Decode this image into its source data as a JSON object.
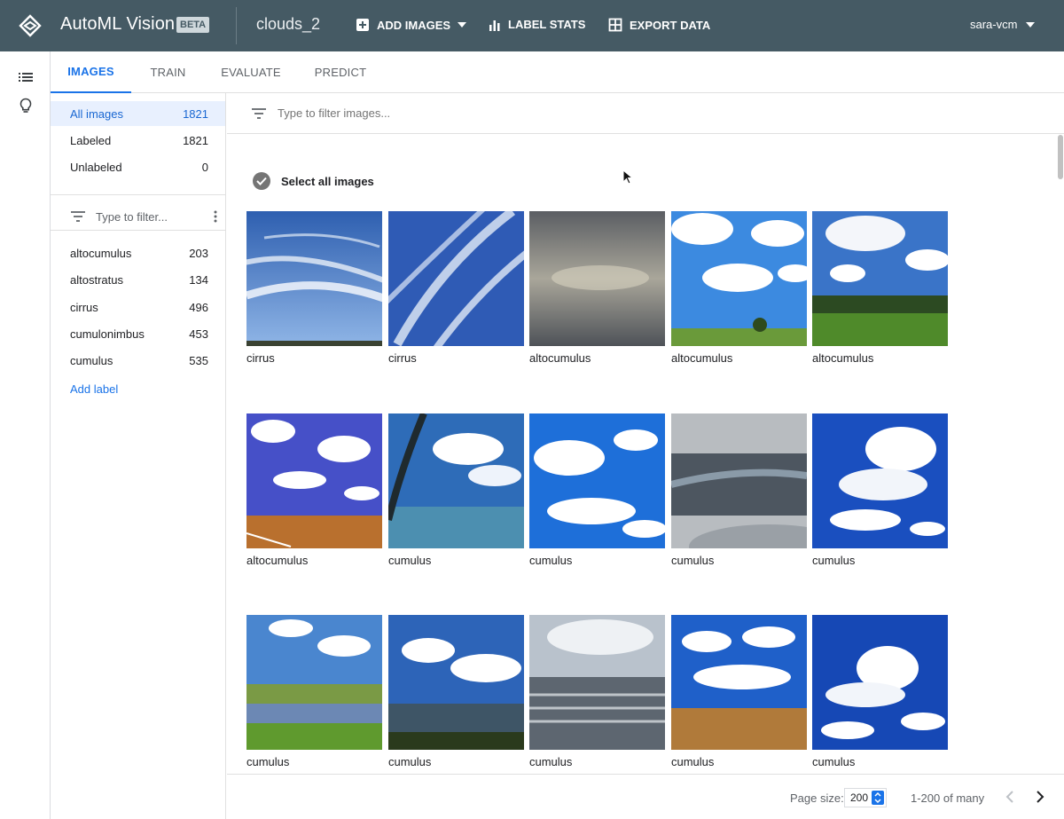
{
  "header": {
    "app_title": "AutoML Vision",
    "badge": "BETA",
    "dataset_name": "clouds_2",
    "add_images": "ADD IMAGES",
    "label_stats": "LABEL STATS",
    "export_data": "EXPORT DATA",
    "user": "sara-vcm"
  },
  "tabs": [
    "IMAGES",
    "TRAIN",
    "EVALUATE",
    "PREDICT"
  ],
  "sidebar": {
    "filters": [
      {
        "label": "All images",
        "count": "1821"
      },
      {
        "label": "Labeled",
        "count": "1821"
      },
      {
        "label": "Unlabeled",
        "count": "0"
      }
    ],
    "filter_placeholder": "Type to filter...",
    "labels": [
      {
        "label": "altocumulus",
        "count": "203"
      },
      {
        "label": "altostratus",
        "count": "134"
      },
      {
        "label": "cirrus",
        "count": "496"
      },
      {
        "label": "cumulonimbus",
        "count": "453"
      },
      {
        "label": "cumulus",
        "count": "535"
      }
    ],
    "add_label": "Add label"
  },
  "main": {
    "filter_placeholder": "Type to filter images...",
    "select_all": "Select all images",
    "images": [
      {
        "label": "cirrus",
        "icon": "cirrus-photo"
      },
      {
        "label": "cirrus",
        "icon": "cirrus-photo"
      },
      {
        "label": "altocumulus",
        "icon": "grey-sky-photo"
      },
      {
        "label": "altocumulus",
        "icon": "field-sky-photo"
      },
      {
        "label": "altocumulus",
        "icon": "field-sky-photo"
      },
      {
        "label": "altocumulus",
        "icon": "desert-sky-photo"
      },
      {
        "label": "cumulus",
        "icon": "beach-sky-photo"
      },
      {
        "label": "cumulus",
        "icon": "blue-sky-photo"
      },
      {
        "label": "cumulus",
        "icon": "aerial-photo"
      },
      {
        "label": "cumulus",
        "icon": "blue-sky-photo"
      },
      {
        "label": "cumulus",
        "icon": "lake-sky-photo"
      },
      {
        "label": "cumulus",
        "icon": "lake-sky-photo"
      },
      {
        "label": "cumulus",
        "icon": "sea-sky-photo"
      },
      {
        "label": "cumulus",
        "icon": "field-sky-photo"
      },
      {
        "label": "cumulus",
        "icon": "blue-sky-photo"
      }
    ]
  },
  "pagination": {
    "page_size_label": "Page size:",
    "page_size": "200",
    "range": "1-200 of many"
  },
  "colors": {
    "topbar": "#455a64",
    "accent": "#1a73e8"
  }
}
